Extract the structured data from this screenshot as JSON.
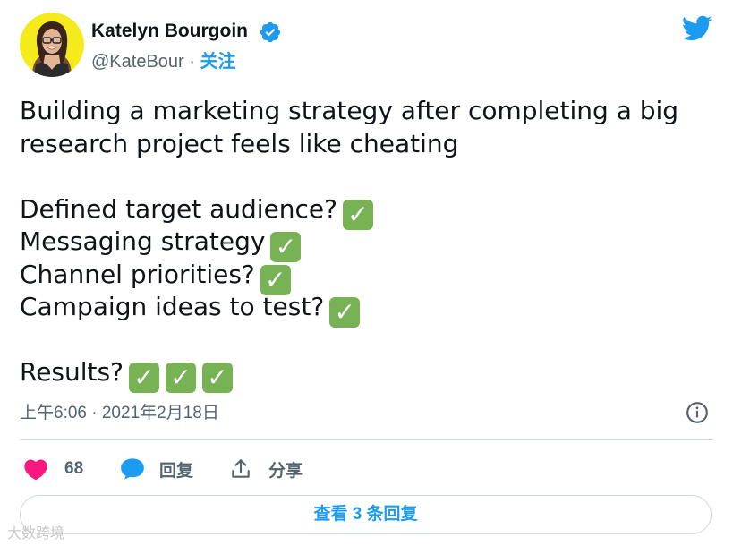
{
  "author": {
    "name": "Katelyn Bourgoin",
    "handle": "@KateBour",
    "separator": "·",
    "follow_label": "关注",
    "verified": true
  },
  "tweet": {
    "lines": [
      "Building a marketing strategy after completing a big",
      "research project feels like cheating",
      "",
      "Defined target audience?",
      "Messaging strategy",
      "Channel priorities?",
      "Campaign ideas to test?",
      "",
      "Results?"
    ],
    "check_mark": "✓"
  },
  "timestamp": "上午6:06 · 2021年2月18日",
  "actions": {
    "like_count": "68",
    "reply_label": "回复",
    "share_label": "分享"
  },
  "view_replies_label": "查看 3 条回复",
  "watermark": "大数跨境",
  "colors": {
    "accent": "#1d9bf0",
    "like": "#f91880",
    "check": "#77b255",
    "secondary_text": "#536471"
  },
  "icons": {
    "verified": "verified-badge-icon",
    "twitter": "twitter-bird-icon",
    "info": "info-icon",
    "like": "heart-icon",
    "reply": "speech-bubble-icon",
    "share": "share-upload-icon"
  }
}
